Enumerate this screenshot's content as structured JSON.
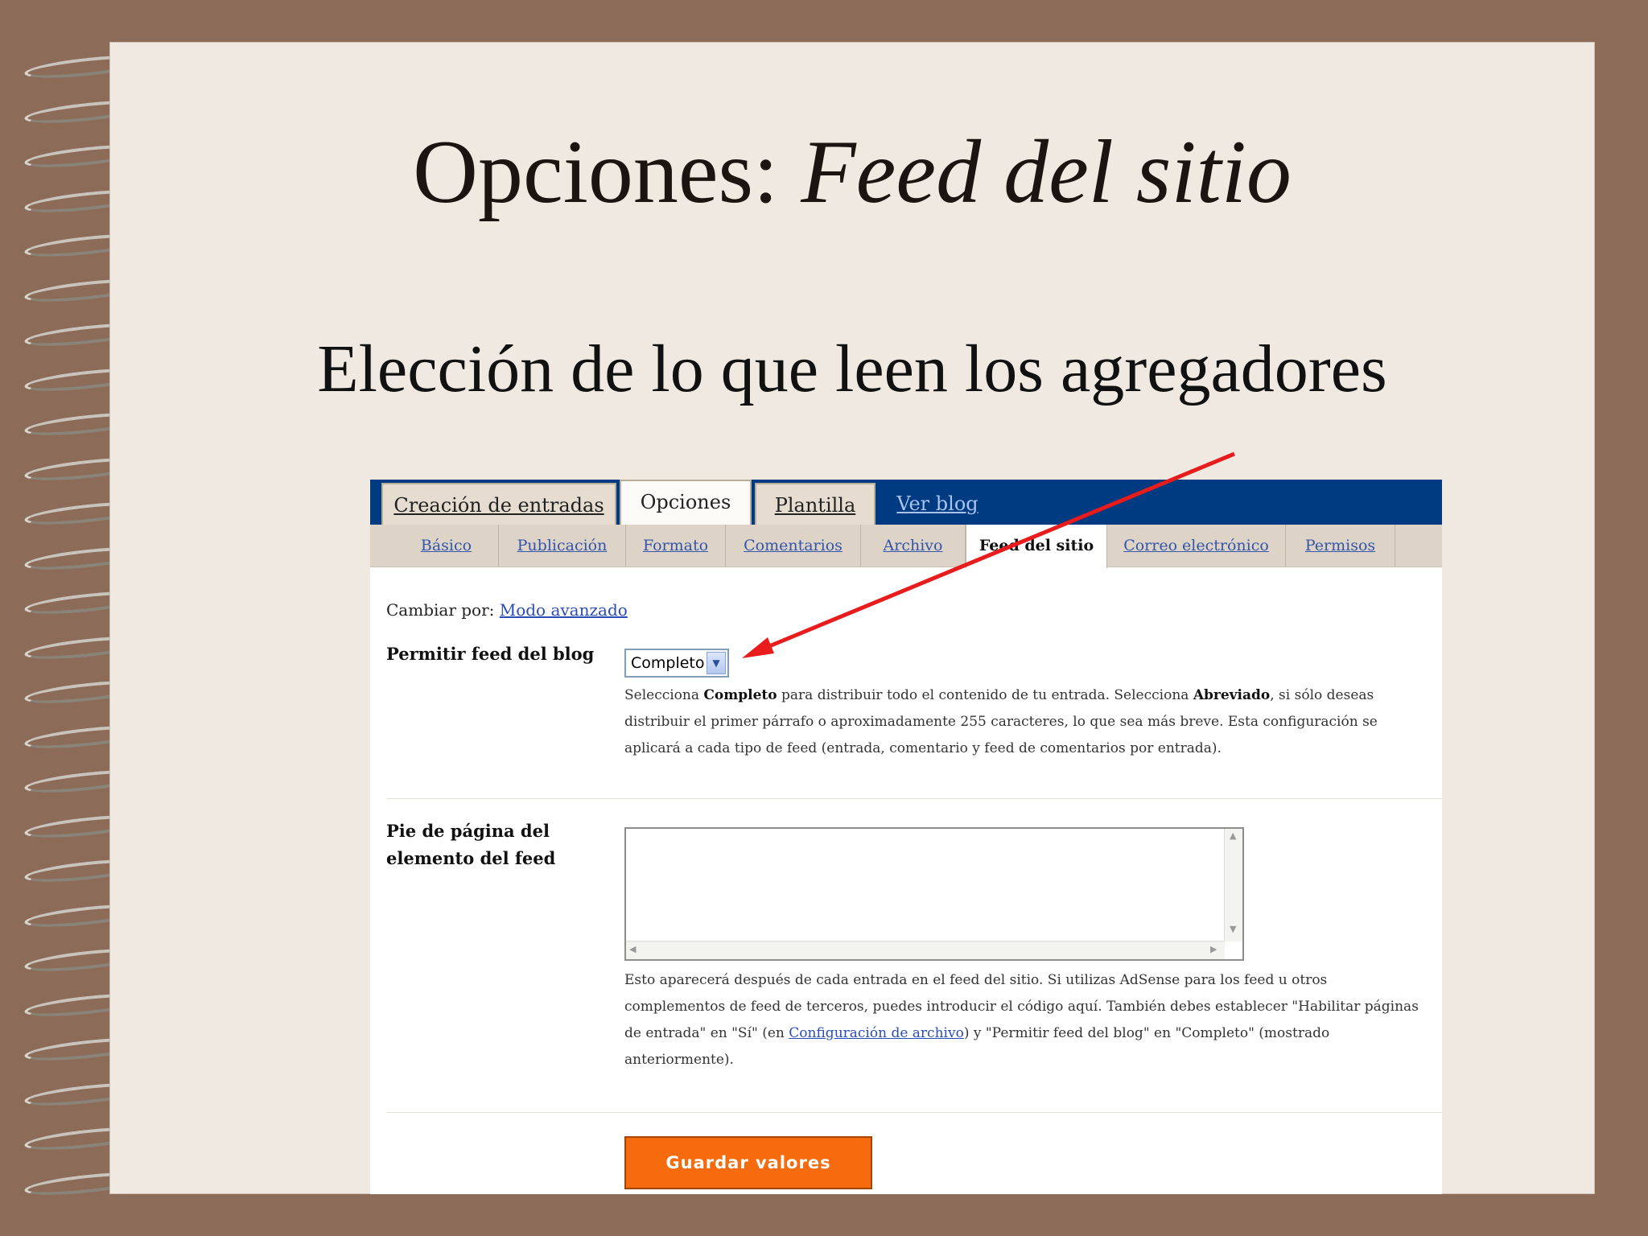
{
  "slide": {
    "title_main": "Opciones: ",
    "title_italic": "Feed del sitio",
    "subtitle": "Elección de lo que leen los agregadores"
  },
  "tabs": [
    {
      "label": "Creación de entradas"
    },
    {
      "label": "Opciones"
    },
    {
      "label": "Plantilla"
    },
    {
      "label": "Ver blog"
    }
  ],
  "subtabs": [
    {
      "label": "Básico"
    },
    {
      "label": "Publicación"
    },
    {
      "label": "Formato"
    },
    {
      "label": "Comentarios"
    },
    {
      "label": "Archivo"
    },
    {
      "label": "Feed del sitio"
    },
    {
      "label": "Correo electrónico"
    },
    {
      "label": "Permisos"
    }
  ],
  "mode": {
    "prefix": "Cambiar por:",
    "link": "Modo avanzado"
  },
  "feed_setting": {
    "label": "Permitir feed del blog",
    "selected": "Completo",
    "help": {
      "p1": "Selecciona ",
      "b1": "Completo",
      "p2": " para distribuir todo el contenido de tu entrada. Selecciona ",
      "b2": "Abreviado",
      "p3": ", si sólo deseas distribuir el primer párrafo o aproximadamente 255 caracteres, lo que sea más breve. Esta configuración se aplicará a cada tipo de feed (entrada, comentario y feed de comentarios por entrada)."
    }
  },
  "footer_setting": {
    "label_line1": "Pie de página del",
    "label_line2": "elemento del feed",
    "value": "",
    "help": {
      "p1": "Esto aparecerá después de cada entrada en el feed del sitio. Si utilizas AdSense para los feed u otros complementos de feed de terceros, puedes introducir el código aquí. También debes establecer \"Habilitar páginas de entrada\" en \"Sí\" (en ",
      "link": "Configuración de archivo",
      "p2": ") y \"Permitir feed del blog\" en \"Completo\" (mostrado anteriormente)."
    }
  },
  "save_button": "Guardar valores",
  "colors": {
    "nav_bar": "#003a80",
    "save_button": "#f56b0e",
    "annotation_arrow": "#e81c1c"
  },
  "icons": {
    "dropdown": "chevron-down-icon",
    "binding": "spiral-binding"
  }
}
